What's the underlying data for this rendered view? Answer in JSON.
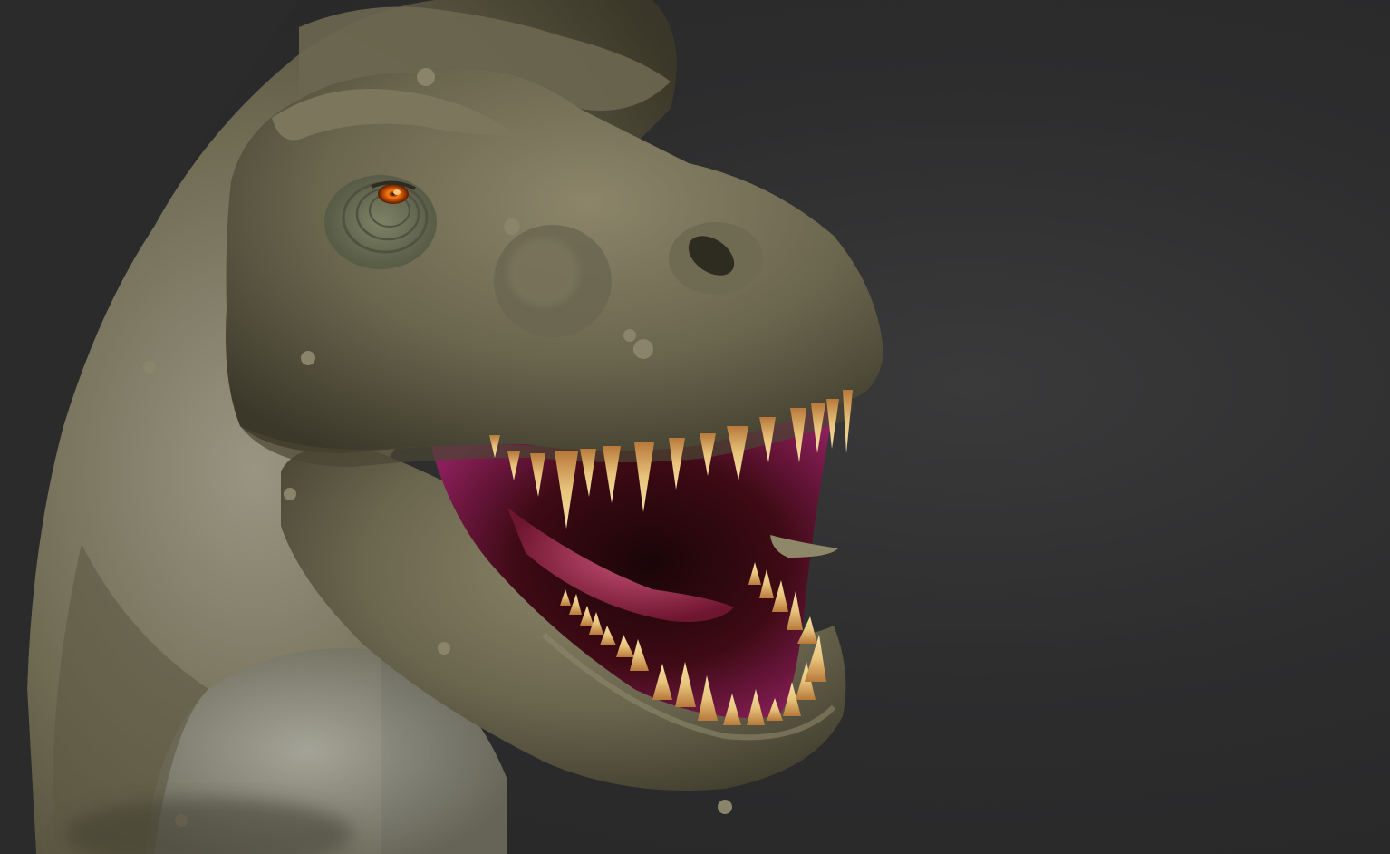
{
  "viewport": {
    "background_color": "#2d2d2e",
    "subject": "t-rex-head-sculpt"
  },
  "model": {
    "skin_color": "#6e6a52",
    "skin_highlight": "#8e876a",
    "skin_shadow": "#3d3a2b",
    "belly_color": "#9a9a8e",
    "mouth_color": "#8a1f5a",
    "tongue_color": "#c2416f",
    "tooth_color": "#e6c27a",
    "eye_color": "#ff6a00"
  }
}
